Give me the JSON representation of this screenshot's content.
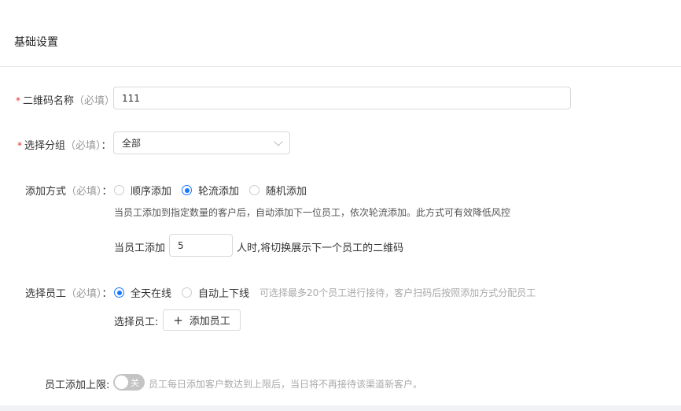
{
  "section": {
    "title": "基础设置"
  },
  "qrcode_name": {
    "required_mark": "*",
    "label": "二维码名称",
    "hint": "（必填）",
    "colon": "",
    "value": "111"
  },
  "group": {
    "required_mark": "*",
    "label": "选择分组",
    "hint": "（必填）",
    "colon": "：",
    "selected": "全部"
  },
  "add_mode": {
    "label": "添加方式",
    "hint": "（必填）",
    "colon": "：",
    "options": [
      {
        "label": "顺序添加",
        "checked": false
      },
      {
        "label": "轮流添加",
        "checked": true
      },
      {
        "label": "随机添加",
        "checked": false
      }
    ],
    "description": "当员工添加到指定数量的客户后，自动添加下一位员工，依次轮流添加。此方式可有效降低风控",
    "threshold_prefix": "当员工添加",
    "threshold_value": "5",
    "threshold_suffix": "人时,将切换展示下一个员工的二维码"
  },
  "staff": {
    "label": "选择员工",
    "hint": "（必填）",
    "colon": "：",
    "options": [
      {
        "label": "全天在线",
        "checked": true
      },
      {
        "label": "自动上下线",
        "checked": false
      }
    ],
    "tip": "可选择最多20个员工进行接待，客户扫码后按照添加方式分配员工",
    "select_label": "选择员工:",
    "add_button": "添加员工"
  },
  "limit": {
    "label": "员工添加上限:",
    "toggle_text": "关",
    "toggle_on": false,
    "description": "员工每日添加客户数达到上限后，当日将不再接待该渠道新客户。"
  }
}
